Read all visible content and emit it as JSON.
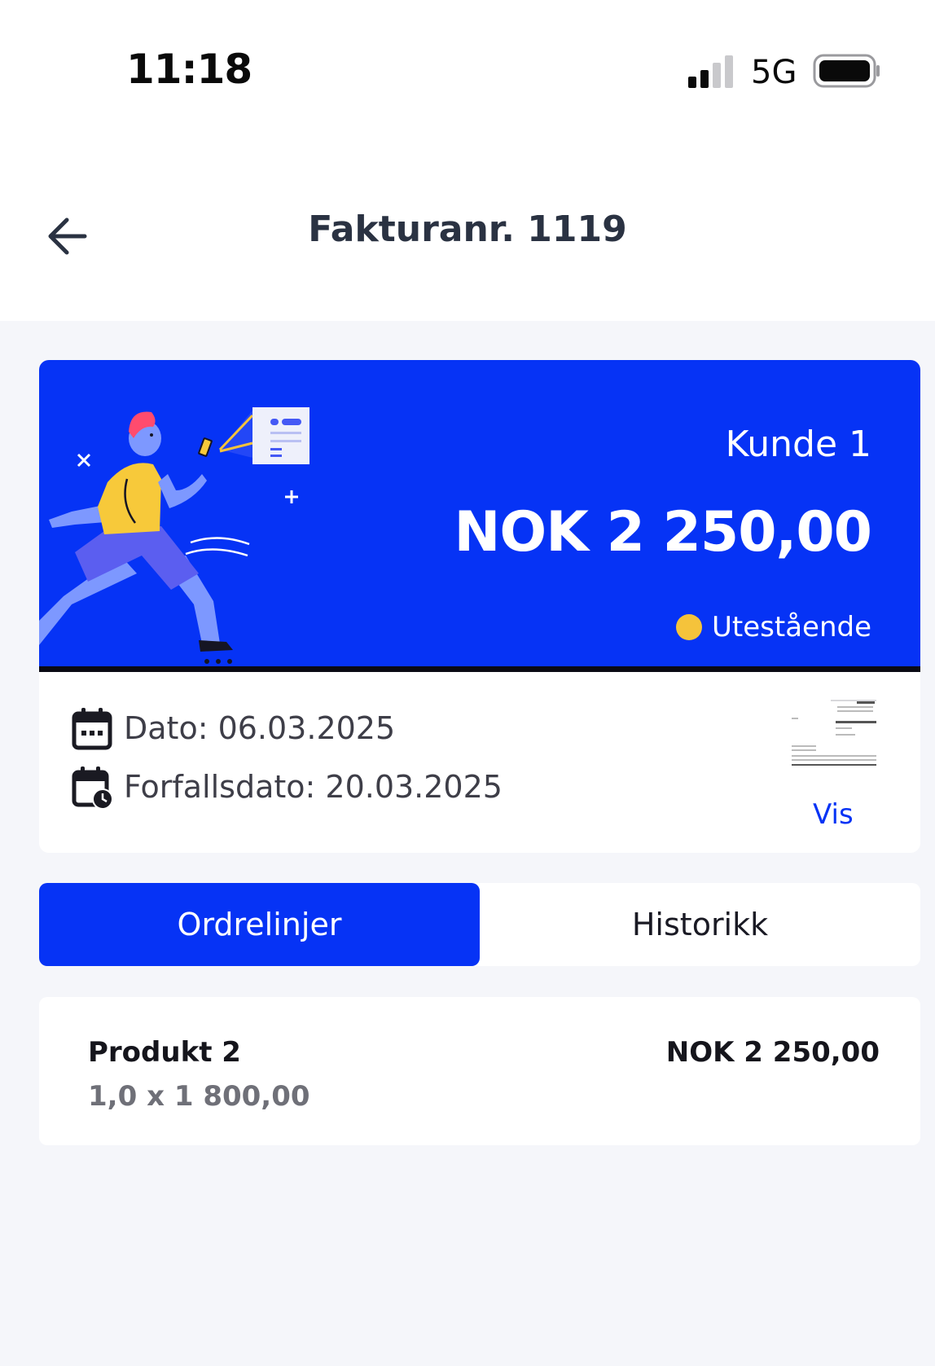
{
  "status_bar": {
    "time": "11:18",
    "network": "5G"
  },
  "nav": {
    "title": "Fakturanr. 1119"
  },
  "invoice": {
    "customer": "Kunde 1",
    "amount": "NOK 2 250,00",
    "status": "Utestående",
    "status_color": "#f5c33b",
    "accent_color": "#0633f5"
  },
  "dates": {
    "date": "Dato: 06.03.2025",
    "due_date": "Forfallsdato: 20.03.2025",
    "view_label": "Vis"
  },
  "tabs": [
    {
      "label": "Ordrelinjer",
      "active": true
    },
    {
      "label": "Historikk",
      "active": false
    }
  ],
  "order_lines": [
    {
      "name": "Produkt 2",
      "qty_price": "1,0 x 1 800,00",
      "amount": "NOK 2 250,00"
    }
  ]
}
